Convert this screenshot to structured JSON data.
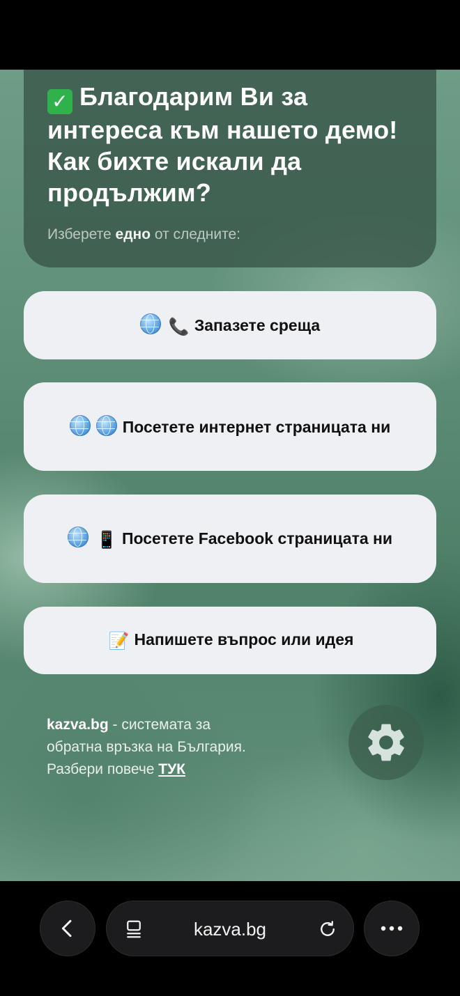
{
  "header": {
    "check_emoji": "✓",
    "title": "Благодарим Ви за интереса към нашето демо! Как бихте искали да продължим?",
    "subtitle_before": "Изберете ",
    "subtitle_bold": "едно",
    "subtitle_after": " от следните:"
  },
  "options": [
    {
      "label": "Запазете среща",
      "icons": [
        "globe-icon",
        "phone-icon"
      ],
      "emoji": "📞"
    },
    {
      "label": "Посетете интернет страницата ни",
      "icons": [
        "globe-icon",
        "globe-icon"
      ]
    },
    {
      "label": "Посетете Facebook страницата ни",
      "icons": [
        "globe-icon",
        "mobile-phone-icon"
      ],
      "emoji": "📱"
    },
    {
      "label": "Напишете въпрос или идея",
      "icons": [
        "memo-icon"
      ],
      "emoji": "📝"
    }
  ],
  "footer": {
    "brand": "kazva.bg",
    "line1_rest": " - системата за",
    "line2": "обратна връзка на България.",
    "line3": "Разбери повече ",
    "link": "ТУК"
  },
  "browser": {
    "url": "kazva.bg"
  },
  "colors": {
    "option_bg": "#eef0f4",
    "header_bg": "#37554699",
    "check_green": "#2fb24c"
  }
}
